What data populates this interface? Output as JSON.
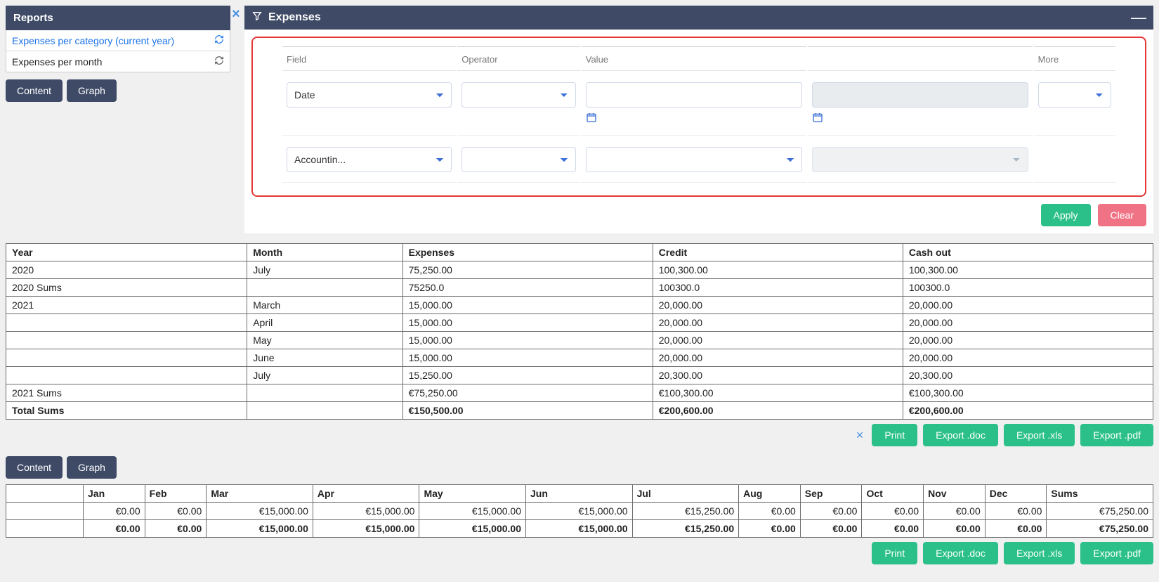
{
  "sidebar": {
    "title": "Reports",
    "items": [
      {
        "label": "Expenses per category (current year)",
        "active": true
      },
      {
        "label": "Expenses per month",
        "active": false
      }
    ],
    "content_btn": "Content",
    "graph_btn": "Graph"
  },
  "main": {
    "title": "Expenses",
    "close_x": "×",
    "minimize": "—"
  },
  "filter": {
    "heads": {
      "field": "Field",
      "operator": "Operator",
      "value": "Value",
      "more": "More"
    },
    "rows": [
      {
        "field": "Date",
        "operator": "",
        "val1": "",
        "val2": "",
        "more": ""
      },
      {
        "field": "Accountin...",
        "operator": "",
        "val1": "",
        "val2": "",
        "more": ""
      }
    ]
  },
  "actions": {
    "apply": "Apply",
    "clear": "Clear"
  },
  "table1": {
    "headers": [
      "Year",
      "Month",
      "Expenses",
      "Credit",
      "Cash out"
    ],
    "rows": [
      {
        "year": "2020",
        "month": "July",
        "exp": "75,250.00",
        "credit": "100,300.00",
        "cash": "100,300.00",
        "style": ""
      },
      {
        "year": "2020 Sums",
        "month": "",
        "exp": "75250.0",
        "credit": "100300.0",
        "cash": "100300.0",
        "style": "semi"
      },
      {
        "year": "2021",
        "month": "March",
        "exp": "15,000.00",
        "credit": "20,000.00",
        "cash": "20,000.00",
        "style": ""
      },
      {
        "year": "",
        "month": "April",
        "exp": "15,000.00",
        "credit": "20,000.00",
        "cash": "20,000.00",
        "style": ""
      },
      {
        "year": "",
        "month": "May",
        "exp": "15,000.00",
        "credit": "20,000.00",
        "cash": "20,000.00",
        "style": ""
      },
      {
        "year": "",
        "month": "June",
        "exp": "15,000.00",
        "credit": "20,000.00",
        "cash": "20,000.00",
        "style": ""
      },
      {
        "year": "",
        "month": "July",
        "exp": "15,250.00",
        "credit": "20,300.00",
        "cash": "20,300.00",
        "style": ""
      },
      {
        "year": "2021 Sums",
        "month": "",
        "exp": "€75,250.00",
        "credit": "€100,300.00",
        "cash": "€100,300.00",
        "style": "semi"
      },
      {
        "year": "Total Sums",
        "month": "",
        "exp": "€150,500.00",
        "credit": "€200,600.00",
        "cash": "€200,600.00",
        "style": "bold"
      }
    ]
  },
  "toolbar": {
    "close": "×",
    "print": "Print",
    "export_doc": "Export .doc",
    "export_xls": "Export .xls",
    "export_pdf": "Export .pdf"
  },
  "tabs2": {
    "content": "Content",
    "graph": "Graph"
  },
  "table2": {
    "headers": [
      "",
      "Jan",
      "Feb",
      "Mar",
      "Apr",
      "May",
      "Jun",
      "Jul",
      "Aug",
      "Sep",
      "Oct",
      "Nov",
      "Dec",
      "Sums"
    ],
    "rows": [
      {
        "blank": "",
        "cells": [
          "€0.00",
          "€0.00",
          "€15,000.00",
          "€15,000.00",
          "€15,000.00",
          "€15,000.00",
          "€15,250.00",
          "€0.00",
          "€0.00",
          "€0.00",
          "€0.00",
          "€0.00",
          "€75,250.00"
        ],
        "style": ""
      },
      {
        "blank": "",
        "cells": [
          "€0.00",
          "€0.00",
          "€15,000.00",
          "€15,000.00",
          "€15,000.00",
          "€15,000.00",
          "€15,250.00",
          "€0.00",
          "€0.00",
          "€0.00",
          "€0.00",
          "€0.00",
          "€75,250.00"
        ],
        "style": "bold"
      }
    ]
  }
}
